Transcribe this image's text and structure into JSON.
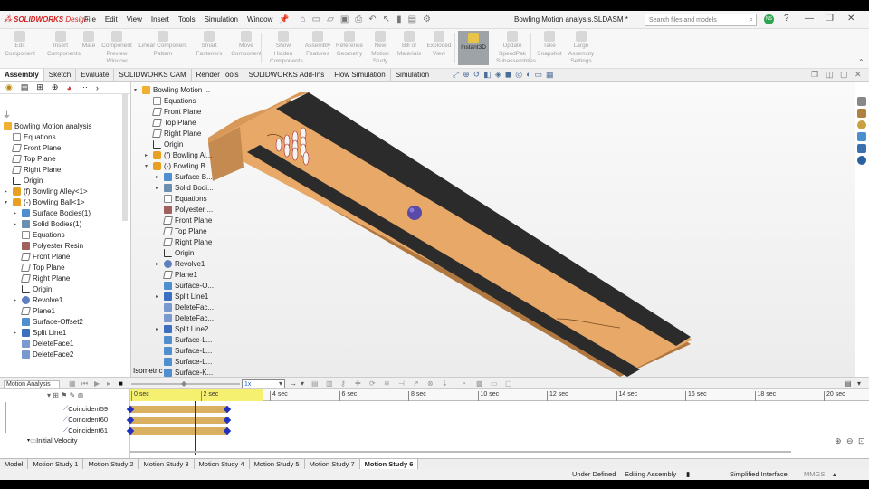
{
  "app": {
    "logo_brand": "SOLIDWORKS",
    "logo_suffix": "Design"
  },
  "menu": [
    "File",
    "Edit",
    "View",
    "Insert",
    "Tools",
    "Simulation",
    "Window"
  ],
  "doc_title": "Bowling Motion analysis.SLDASM *",
  "search": {
    "placeholder": "Search files and models"
  },
  "user_initials": "NS",
  "ribbon": [
    {
      "label": "Edit Component",
      "active": false
    },
    {
      "label": "Insert Components",
      "active": false
    },
    {
      "label": "Mate",
      "active": false
    },
    {
      "label": "Component Preview Window",
      "active": false
    },
    {
      "label": "Linear Component Pattern",
      "active": false
    },
    {
      "label": "Smart Fasteners",
      "active": false
    },
    {
      "label": "Move Component",
      "active": false
    },
    {
      "label": "Show Hidden Components",
      "active": false
    },
    {
      "label": "Assembly Features",
      "active": false
    },
    {
      "label": "Reference Geometry",
      "active": false
    },
    {
      "label": "New Motion Study",
      "active": false
    },
    {
      "label": "Bill of Materials",
      "active": false
    },
    {
      "label": "Exploded View",
      "active": false
    },
    {
      "label": "Instant3D",
      "active": true
    },
    {
      "label": "Update SpeedPak Subassemblies",
      "active": false
    },
    {
      "label": "Take Snapshot",
      "active": false
    },
    {
      "label": "Large Assembly Settings",
      "active": false
    }
  ],
  "cmd_tabs": [
    {
      "label": "Assembly",
      "active": true
    },
    {
      "label": "Sketch",
      "active": false
    },
    {
      "label": "Evaluate",
      "active": false
    },
    {
      "label": "SOLIDWORKS CAM",
      "active": false
    },
    {
      "label": "Render Tools",
      "active": false
    },
    {
      "label": "SOLIDWORKS Add-Ins",
      "active": false
    },
    {
      "label": "Flow Simulation",
      "active": false
    },
    {
      "label": "Simulation",
      "active": false
    }
  ],
  "tree": [
    {
      "label": "Bowling Motion analysis",
      "icon": "asm",
      "indent": 0,
      "arrow": ""
    },
    {
      "label": "Equations",
      "icon": "doc",
      "indent": 1,
      "arrow": ""
    },
    {
      "label": "Front Plane",
      "icon": "plane",
      "indent": 1,
      "arrow": ""
    },
    {
      "label": "Top Plane",
      "icon": "plane",
      "indent": 1,
      "arrow": ""
    },
    {
      "label": "Right Plane",
      "icon": "plane",
      "indent": 1,
      "arrow": ""
    },
    {
      "label": "Origin",
      "icon": "origin",
      "indent": 1,
      "arrow": ""
    },
    {
      "label": "(f) Bowling Alley<1>",
      "icon": "part",
      "indent": 1,
      "arrow": "▸"
    },
    {
      "label": "(-) Bowling Ball<1>",
      "icon": "part",
      "indent": 1,
      "arrow": "▾"
    },
    {
      "label": "Surface Bodies(1)",
      "icon": "surf",
      "indent": 2,
      "arrow": "▸"
    },
    {
      "label": "Solid Bodies(1)",
      "icon": "solid",
      "indent": 2,
      "arrow": "▸"
    },
    {
      "label": "Equations",
      "icon": "doc",
      "indent": 2,
      "arrow": ""
    },
    {
      "label": "Polyester Resin",
      "icon": "mat",
      "indent": 2,
      "arrow": ""
    },
    {
      "label": "Front Plane",
      "icon": "plane",
      "indent": 2,
      "arrow": ""
    },
    {
      "label": "Top Plane",
      "icon": "plane",
      "indent": 2,
      "arrow": ""
    },
    {
      "label": "Right Plane",
      "icon": "plane",
      "indent": 2,
      "arrow": ""
    },
    {
      "label": "Origin",
      "icon": "origin",
      "indent": 2,
      "arrow": ""
    },
    {
      "label": "Revolve1",
      "icon": "feat",
      "indent": 2,
      "arrow": "▸"
    },
    {
      "label": "Plane1",
      "icon": "plane",
      "indent": 2,
      "arrow": ""
    },
    {
      "label": "Surface-Offset2",
      "icon": "surf",
      "indent": 2,
      "arrow": ""
    },
    {
      "label": "Split Line1",
      "icon": "blue",
      "indent": 2,
      "arrow": "▸"
    },
    {
      "label": "DeleteFace1",
      "icon": "del",
      "indent": 2,
      "arrow": ""
    },
    {
      "label": "DeleteFace2",
      "icon": "del",
      "indent": 2,
      "arrow": ""
    }
  ],
  "flyout": [
    {
      "label": "Bowling Motion ...",
      "icon": "asm",
      "indent": 0,
      "arrow": "▾"
    },
    {
      "label": "Equations",
      "icon": "doc",
      "indent": 1,
      "arrow": ""
    },
    {
      "label": "Front Plane",
      "icon": "plane",
      "indent": 1,
      "arrow": ""
    },
    {
      "label": "Top Plane",
      "icon": "plane",
      "indent": 1,
      "arrow": ""
    },
    {
      "label": "Right Plane",
      "icon": "plane",
      "indent": 1,
      "arrow": ""
    },
    {
      "label": "Origin",
      "icon": "origin",
      "indent": 1,
      "arrow": ""
    },
    {
      "label": "(f) Bowling Al...",
      "icon": "part",
      "indent": 1,
      "arrow": "▸"
    },
    {
      "label": "(-) Bowling B...",
      "icon": "part",
      "indent": 1,
      "arrow": "▾"
    },
    {
      "label": "Surface B...",
      "icon": "surf",
      "indent": 2,
      "arrow": "▸"
    },
    {
      "label": "Solid Bodi...",
      "icon": "solid",
      "indent": 2,
      "arrow": "▸"
    },
    {
      "label": "Equations",
      "icon": "doc",
      "indent": 2,
      "arrow": ""
    },
    {
      "label": "Polyester ...",
      "icon": "mat",
      "indent": 2,
      "arrow": ""
    },
    {
      "label": "Front Plane",
      "icon": "plane",
      "indent": 2,
      "arrow": ""
    },
    {
      "label": "Top Plane",
      "icon": "plane",
      "indent": 2,
      "arrow": ""
    },
    {
      "label": "Right Plane",
      "icon": "plane",
      "indent": 2,
      "arrow": ""
    },
    {
      "label": "Origin",
      "icon": "origin",
      "indent": 2,
      "arrow": ""
    },
    {
      "label": "Revolve1",
      "icon": "feat",
      "indent": 2,
      "arrow": "▸"
    },
    {
      "label": "Plane1",
      "icon": "plane",
      "indent": 2,
      "arrow": ""
    },
    {
      "label": "Surface-O...",
      "icon": "surf",
      "indent": 2,
      "arrow": ""
    },
    {
      "label": "Split Line1",
      "icon": "blue",
      "indent": 2,
      "arrow": "▸"
    },
    {
      "label": "DeleteFac...",
      "icon": "del",
      "indent": 2,
      "arrow": ""
    },
    {
      "label": "DeleteFac...",
      "icon": "del",
      "indent": 2,
      "arrow": ""
    },
    {
      "label": "Split Line2",
      "icon": "blue",
      "indent": 2,
      "arrow": "▸"
    },
    {
      "label": "Surface-L...",
      "icon": "surf",
      "indent": 2,
      "arrow": ""
    },
    {
      "label": "Surface-L...",
      "icon": "surf",
      "indent": 2,
      "arrow": ""
    },
    {
      "label": "Surface-L...",
      "icon": "surf",
      "indent": 2,
      "arrow": ""
    },
    {
      "label": "Surface-K...",
      "icon": "surf",
      "indent": 2,
      "arrow": ""
    }
  ],
  "view_label": "Isometric",
  "motion": {
    "study_type": "Motion Analysis",
    "speed": "1x",
    "ticks": [
      "0 sec",
      "2 sec",
      "4 sec",
      "6 sec",
      "8 sec",
      "10 sec",
      "12 sec",
      "14 sec",
      "16 sec",
      "18 sec",
      "20 sec"
    ],
    "rows": [
      {
        "label": "Coincident59",
        "icon": "mate"
      },
      {
        "label": "Coincident60",
        "icon": "mate"
      },
      {
        "label": "Coincident61",
        "icon": "mate"
      },
      {
        "label": "Initial Velocity",
        "icon": "folder"
      }
    ]
  },
  "motion_tabs": [
    {
      "label": "Model",
      "active": false
    },
    {
      "label": "Motion Study 1",
      "active": false
    },
    {
      "label": "Motion Study 2",
      "active": false
    },
    {
      "label": "Motion Study 3",
      "active": false
    },
    {
      "label": "Motion Study 4",
      "active": false
    },
    {
      "label": "Motion Study 5",
      "active": false
    },
    {
      "label": "Motion Study 7",
      "active": false
    },
    {
      "label": "Motion Study 6",
      "active": true
    }
  ],
  "status": {
    "state": "Under Defined",
    "mode": "Editing Assembly",
    "interface": "Simplified Interface",
    "units": "MMGS"
  },
  "colors": {
    "lane": "#e7a868",
    "gutter": "#2b2b2b",
    "ball": "#5a4aa8",
    "track": "#d8b060",
    "key": "#2030c0",
    "timebar": "#f6f070"
  }
}
